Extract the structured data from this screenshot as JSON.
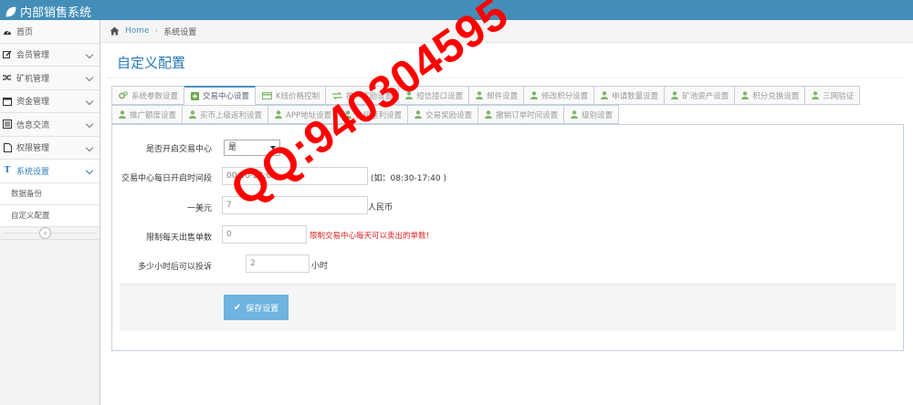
{
  "app": {
    "brand": "内部销售系统"
  },
  "sidebar": {
    "items": [
      {
        "label": "首页",
        "icon": "tachometer-icon"
      },
      {
        "label": "会员管理",
        "icon": "pencil-square-icon"
      },
      {
        "label": "矿机管理",
        "icon": "random-icon"
      },
      {
        "label": "资金管理",
        "icon": "calendar-icon"
      },
      {
        "label": "信息交流",
        "icon": "list-alt-icon"
      },
      {
        "label": "权限管理",
        "icon": "file-icon"
      },
      {
        "label": "系统设置",
        "icon": "text-icon",
        "icon_glyph": "T"
      }
    ],
    "sub_items": [
      {
        "label": "数据备份"
      },
      {
        "label": "自定义配置"
      }
    ],
    "collapse_glyph": "«"
  },
  "breadcrumb": {
    "home": "Home",
    "separator": "›",
    "current": "系统设置"
  },
  "page": {
    "title": "自定义配置"
  },
  "tabs": {
    "row1": [
      {
        "label": "系统参数设置",
        "icon": "cogs-icon"
      },
      {
        "label": "交易中心设置",
        "icon": "plus-square-icon",
        "active": true
      },
      {
        "label": "K线价格控制",
        "icon": "credit-card-icon"
      },
      {
        "label": "推广奖励设置",
        "icon": "exchange-icon"
      },
      {
        "label": "短信接口设置",
        "icon": "user-icon"
      },
      {
        "label": "邮件设置",
        "icon": "user-icon"
      },
      {
        "label": "修改积分设置",
        "icon": "user-icon"
      },
      {
        "label": "申请数量设置",
        "icon": "user-icon"
      },
      {
        "label": "矿池资产设置",
        "icon": "user-icon"
      },
      {
        "label": "积分兑换设置",
        "icon": "user-icon"
      },
      {
        "label": "三网验证",
        "icon": "user-icon"
      }
    ],
    "row2": [
      {
        "label": "推广额度设置",
        "icon": "user-icon"
      },
      {
        "label": "买币上级返利设置",
        "icon": "user-icon"
      },
      {
        "label": "APP地址设置",
        "icon": "user-icon"
      },
      {
        "label": "上级返利设置",
        "icon": "user-icon"
      },
      {
        "label": "交易奖励设置",
        "icon": "user-icon"
      },
      {
        "label": "撤销订单时间设置",
        "icon": "user-icon"
      },
      {
        "label": "级别设置",
        "icon": "user-icon"
      }
    ]
  },
  "form": {
    "enable_trading": {
      "label": "是否开启交易中心",
      "value": "是"
    },
    "daily_hours": {
      "label": "交易中心每日开启时间段",
      "placeholder": "00:00-24:00",
      "hint": "(如：08:30-17:40 )"
    },
    "usd_rate": {
      "label": "一美元",
      "value": "7",
      "unit": "人民币"
    },
    "daily_limit": {
      "label": "限制每天出售单数",
      "value": "0",
      "hint": "限制交易中心每天可以卖出的单数！"
    },
    "complaint_hours": {
      "label": "多少小时后可以投诉",
      "value": "2",
      "unit": "小时"
    },
    "save_label": "保存设置"
  },
  "watermark": {
    "text": "QQ:940304595",
    "color": "#ff0000"
  },
  "colors": {
    "topbar": "#438eb9",
    "accent": "#2679b5",
    "button": "#6fb3e0",
    "tab_icon": "#69aa46"
  }
}
